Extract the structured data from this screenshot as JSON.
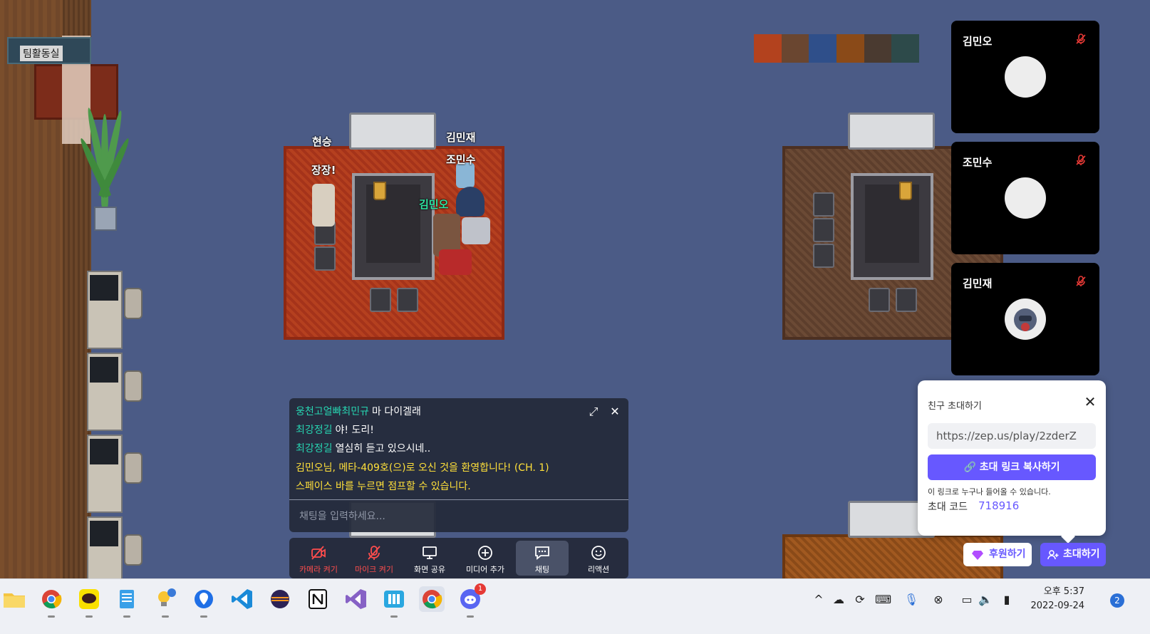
{
  "room": {
    "sign": "팀활동실"
  },
  "avatars": {
    "hyunseung": "현승",
    "jangjang": "장장!",
    "kimminjae": "김민재",
    "jominsu": "조민수",
    "kimminoh": "김민오"
  },
  "video_tiles": [
    {
      "name": "김민오"
    },
    {
      "name": "조민수"
    },
    {
      "name": "김민재"
    }
  ],
  "chat": {
    "messages": [
      {
        "nick": "웅천고얼빠최민규",
        "text": "마 다이겔래"
      },
      {
        "nick": "최강정길",
        "text": "야! 도리!"
      },
      {
        "nick": "최강정길",
        "text": "열심히 듣고 있으시네.."
      }
    ],
    "system": [
      "김민오님, 메타-409호(으)로 오신 것을 환영합니다! (CH. 1)",
      "스페이스 바를 누르면 점프할 수 있습니다."
    ],
    "placeholder": "채팅을 입력하세요..."
  },
  "toolbar": {
    "camera": "카메라 켜기",
    "mic": "마이크 켜기",
    "share": "화면 공유",
    "media": "미디어 추가",
    "chat": "채팅",
    "reaction": "리액션"
  },
  "invite": {
    "title": "친구 초대하기",
    "url": "https://zep.us/play/2zderZ",
    "copy_label": "초대 링크 복사하기",
    "hint": "이 링크로 누구나 들어올 수 있습니다.",
    "code_label": "초대 코드",
    "code_value": "718916"
  },
  "buttons": {
    "sponsor": "후원하기",
    "invite": "초대하기"
  },
  "taskbar": {
    "time_period": "오후 5:37",
    "date": "2022-09-24",
    "notifications": "2",
    "discord_badge": "1",
    "apps": [
      "file-explorer",
      "chrome",
      "kakaotalk",
      "notepad",
      "ideas",
      "maps",
      "vscode",
      "eclipse",
      "notion",
      "visual-studio",
      "app",
      "chrome-active",
      "discord"
    ]
  },
  "colors": {
    "accent": "#6758ff",
    "chat_nick": "#27d4b1",
    "system_msg": "#ffe03a",
    "self_name": "#2fe6a3"
  }
}
